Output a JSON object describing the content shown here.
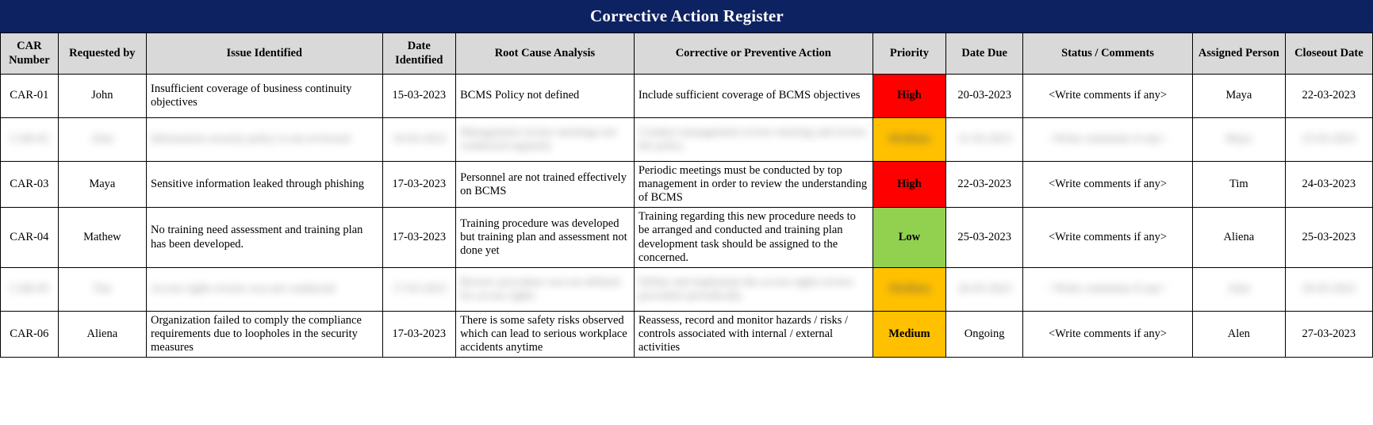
{
  "title": "Corrective Action Register",
  "theme": {
    "title_bar_bg": "#0D2260",
    "title_text": "#FFFFFF",
    "header_bg": "#D9D9D9",
    "grid_line": "#000000",
    "priority_high": "#FF0000",
    "priority_medium": "#FFC000",
    "priority_low": "#92D050"
  },
  "columns": [
    {
      "key": "car_number",
      "label": "CAR Number"
    },
    {
      "key": "requested_by",
      "label": "Requested by"
    },
    {
      "key": "issue_identified",
      "label": "Issue Identified"
    },
    {
      "key": "date_identified",
      "label": "Date Identified"
    },
    {
      "key": "root_cause_analysis",
      "label": "Root Cause Analysis"
    },
    {
      "key": "corrective_action",
      "label": "Corrective or Preventive Action"
    },
    {
      "key": "priority",
      "label": "Priority"
    },
    {
      "key": "date_due",
      "label": "Date Due"
    },
    {
      "key": "status_comments",
      "label": "Status / Comments"
    },
    {
      "key": "assigned_person",
      "label": "Assigned Person"
    },
    {
      "key": "closeout_date",
      "label": "Closeout Date"
    }
  ],
  "rows": [
    {
      "redacted": false,
      "car_number": "CAR-01",
      "requested_by": "John",
      "issue_identified": "Insufficient coverage of business continuity objectives",
      "date_identified": "15-03-2023",
      "root_cause_analysis": "BCMS Policy not defined",
      "corrective_action": "Include sufficient coverage of BCMS objectives",
      "priority": "High",
      "priority_level": "high",
      "date_due": "20-03-2023",
      "status_comments": "<Write comments  if any>",
      "assigned_person": "Maya",
      "closeout_date": "22-03-2023"
    },
    {
      "redacted": true,
      "car_number": "CAR-02",
      "requested_by": "Alen",
      "issue_identified": "Information security policy is not reviewed",
      "date_identified": "16-03-2023",
      "root_cause_analysis": "Management review meetings not conducted regularly",
      "corrective_action": "Conduct management review meeting and review the policy",
      "priority": "Medium",
      "priority_level": "medium",
      "date_due": "21-03-2023",
      "status_comments": "<Write comments  if any>",
      "assigned_person": "Maya",
      "closeout_date": "23-03-2023"
    },
    {
      "redacted": false,
      "car_number": "CAR-03",
      "requested_by": "Maya",
      "issue_identified": "Sensitive information leaked through phishing",
      "date_identified": "17-03-2023",
      "root_cause_analysis": "Personnel are not trained effectively on BCMS",
      "corrective_action": "Periodic meetings must be conducted by top management in order to review the understanding of BCMS",
      "priority": "High",
      "priority_level": "high",
      "date_due": "22-03-2023",
      "status_comments": "<Write comments  if any>",
      "assigned_person": "Tim",
      "closeout_date": "24-03-2023"
    },
    {
      "redacted": false,
      "car_number": "CAR-04",
      "requested_by": "Mathew",
      "issue_identified": "No training need assessment and training plan has been developed.",
      "date_identified": "17-03-2023",
      "root_cause_analysis": "Training procedure was developed but training plan and assessment not done yet",
      "corrective_action": "Training regarding this new procedure needs to be arranged and conducted and training plan development task should be assigned to the concerned.",
      "priority": "Low",
      "priority_level": "low",
      "date_due": "25-03-2023",
      "status_comments": "<Write comments  if any>",
      "assigned_person": "Aliena",
      "closeout_date": "25-03-2023"
    },
    {
      "redacted": true,
      "car_number": "CAR-05",
      "requested_by": "Tim",
      "issue_identified": "Access rights review was not conducted",
      "date_identified": "17-03-2023",
      "root_cause_analysis": "Review procedure was not defined for access rights",
      "corrective_action": "Define and implement the access rights review procedure periodically",
      "priority": "Medium",
      "priority_level": "medium",
      "date_due": "26-03-2023",
      "status_comments": "<Write comments  if any>",
      "assigned_person": "Alen",
      "closeout_date": "26-03-2023"
    },
    {
      "redacted": false,
      "car_number": "CAR-06",
      "requested_by": "Aliena",
      "issue_identified": "Organization failed to comply the compliance requirements due to loopholes in the security measures",
      "date_identified": "17-03-2023",
      "root_cause_analysis": "There is some safety risks observed which can lead to serious workplace accidents anytime",
      "corrective_action": "Reassess, record and monitor hazards / risks / controls associated with internal / external activities",
      "priority": "Medium",
      "priority_level": "medium",
      "date_due": "Ongoing",
      "status_comments": "<Write comments  if any>",
      "assigned_person": "Alen",
      "closeout_date": "27-03-2023"
    }
  ]
}
